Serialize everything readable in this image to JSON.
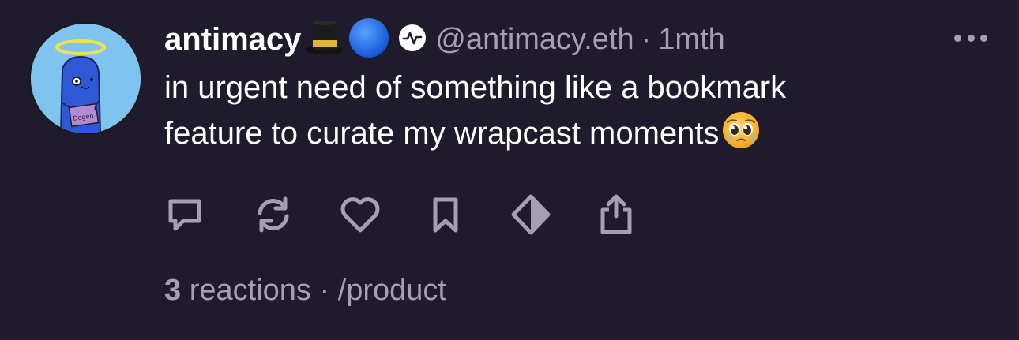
{
  "cast": {
    "author": {
      "display_name": "antimacy",
      "name_emojis": [
        "top-hat-emoji",
        "blue-circle-emoji"
      ],
      "handle": "@antimacy.eth",
      "verified_badge": "activity-badge-icon",
      "avatar_label": "Degen"
    },
    "separator": "·",
    "timestamp": "1mth",
    "text_lines": [
      "in urgent need of something like a bookmark",
      "feature to curate my wrapcast moments"
    ],
    "text_emoji": "pleading-face-emoji",
    "actions": [
      {
        "name": "reply",
        "icon": "comment-icon"
      },
      {
        "name": "recast",
        "icon": "recast-icon"
      },
      {
        "name": "like",
        "icon": "heart-icon"
      },
      {
        "name": "bookmark",
        "icon": "bookmark-icon"
      },
      {
        "name": "tip",
        "icon": "diamond-icon"
      },
      {
        "name": "share",
        "icon": "share-icon"
      }
    ],
    "footer": {
      "reactions_count": "3",
      "reactions_label": "reactions",
      "separator": "·",
      "channel": "/product"
    }
  },
  "colors": {
    "background": "#1f1a2c",
    "primary_text": "#ffffff",
    "secondary_text": "#a59eb5",
    "avatar_bg": "#7fc3ef"
  }
}
